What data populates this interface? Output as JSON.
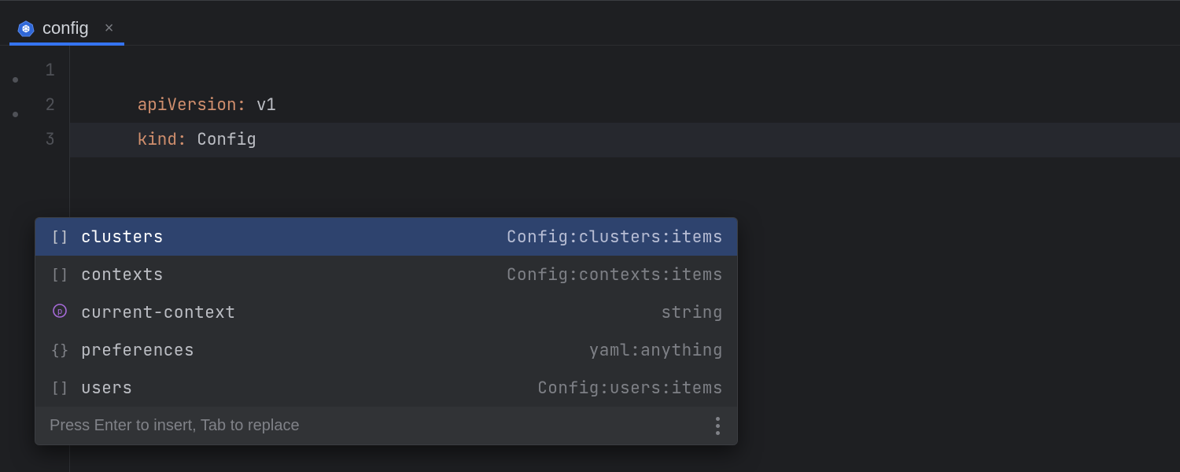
{
  "tabbar": {
    "tabs": [
      {
        "label": "config",
        "active": true
      }
    ]
  },
  "editor": {
    "lines": [
      {
        "num": "1",
        "key": "apiVersion",
        "value": "v1"
      },
      {
        "num": "2",
        "key": "kind",
        "value": "Config"
      },
      {
        "num": "3",
        "key": "",
        "value": ""
      }
    ]
  },
  "autocomplete": {
    "items": [
      {
        "icon": "array",
        "label": "clusters",
        "type": "Config:clusters:items",
        "selected": true
      },
      {
        "icon": "array",
        "label": "contexts",
        "type": "Config:contexts:items",
        "selected": false
      },
      {
        "icon": "property",
        "label": "current-context",
        "type": "string",
        "selected": false
      },
      {
        "icon": "object",
        "label": "preferences",
        "type": "yaml:anything",
        "selected": false
      },
      {
        "icon": "array",
        "label": "users",
        "type": "Config:users:items",
        "selected": false
      }
    ],
    "footer_hint": "Press Enter to insert, Tab to replace"
  },
  "colors": {
    "accent": "#3574f0",
    "selection": "#2e436e",
    "key_token": "#cf8e6d"
  }
}
